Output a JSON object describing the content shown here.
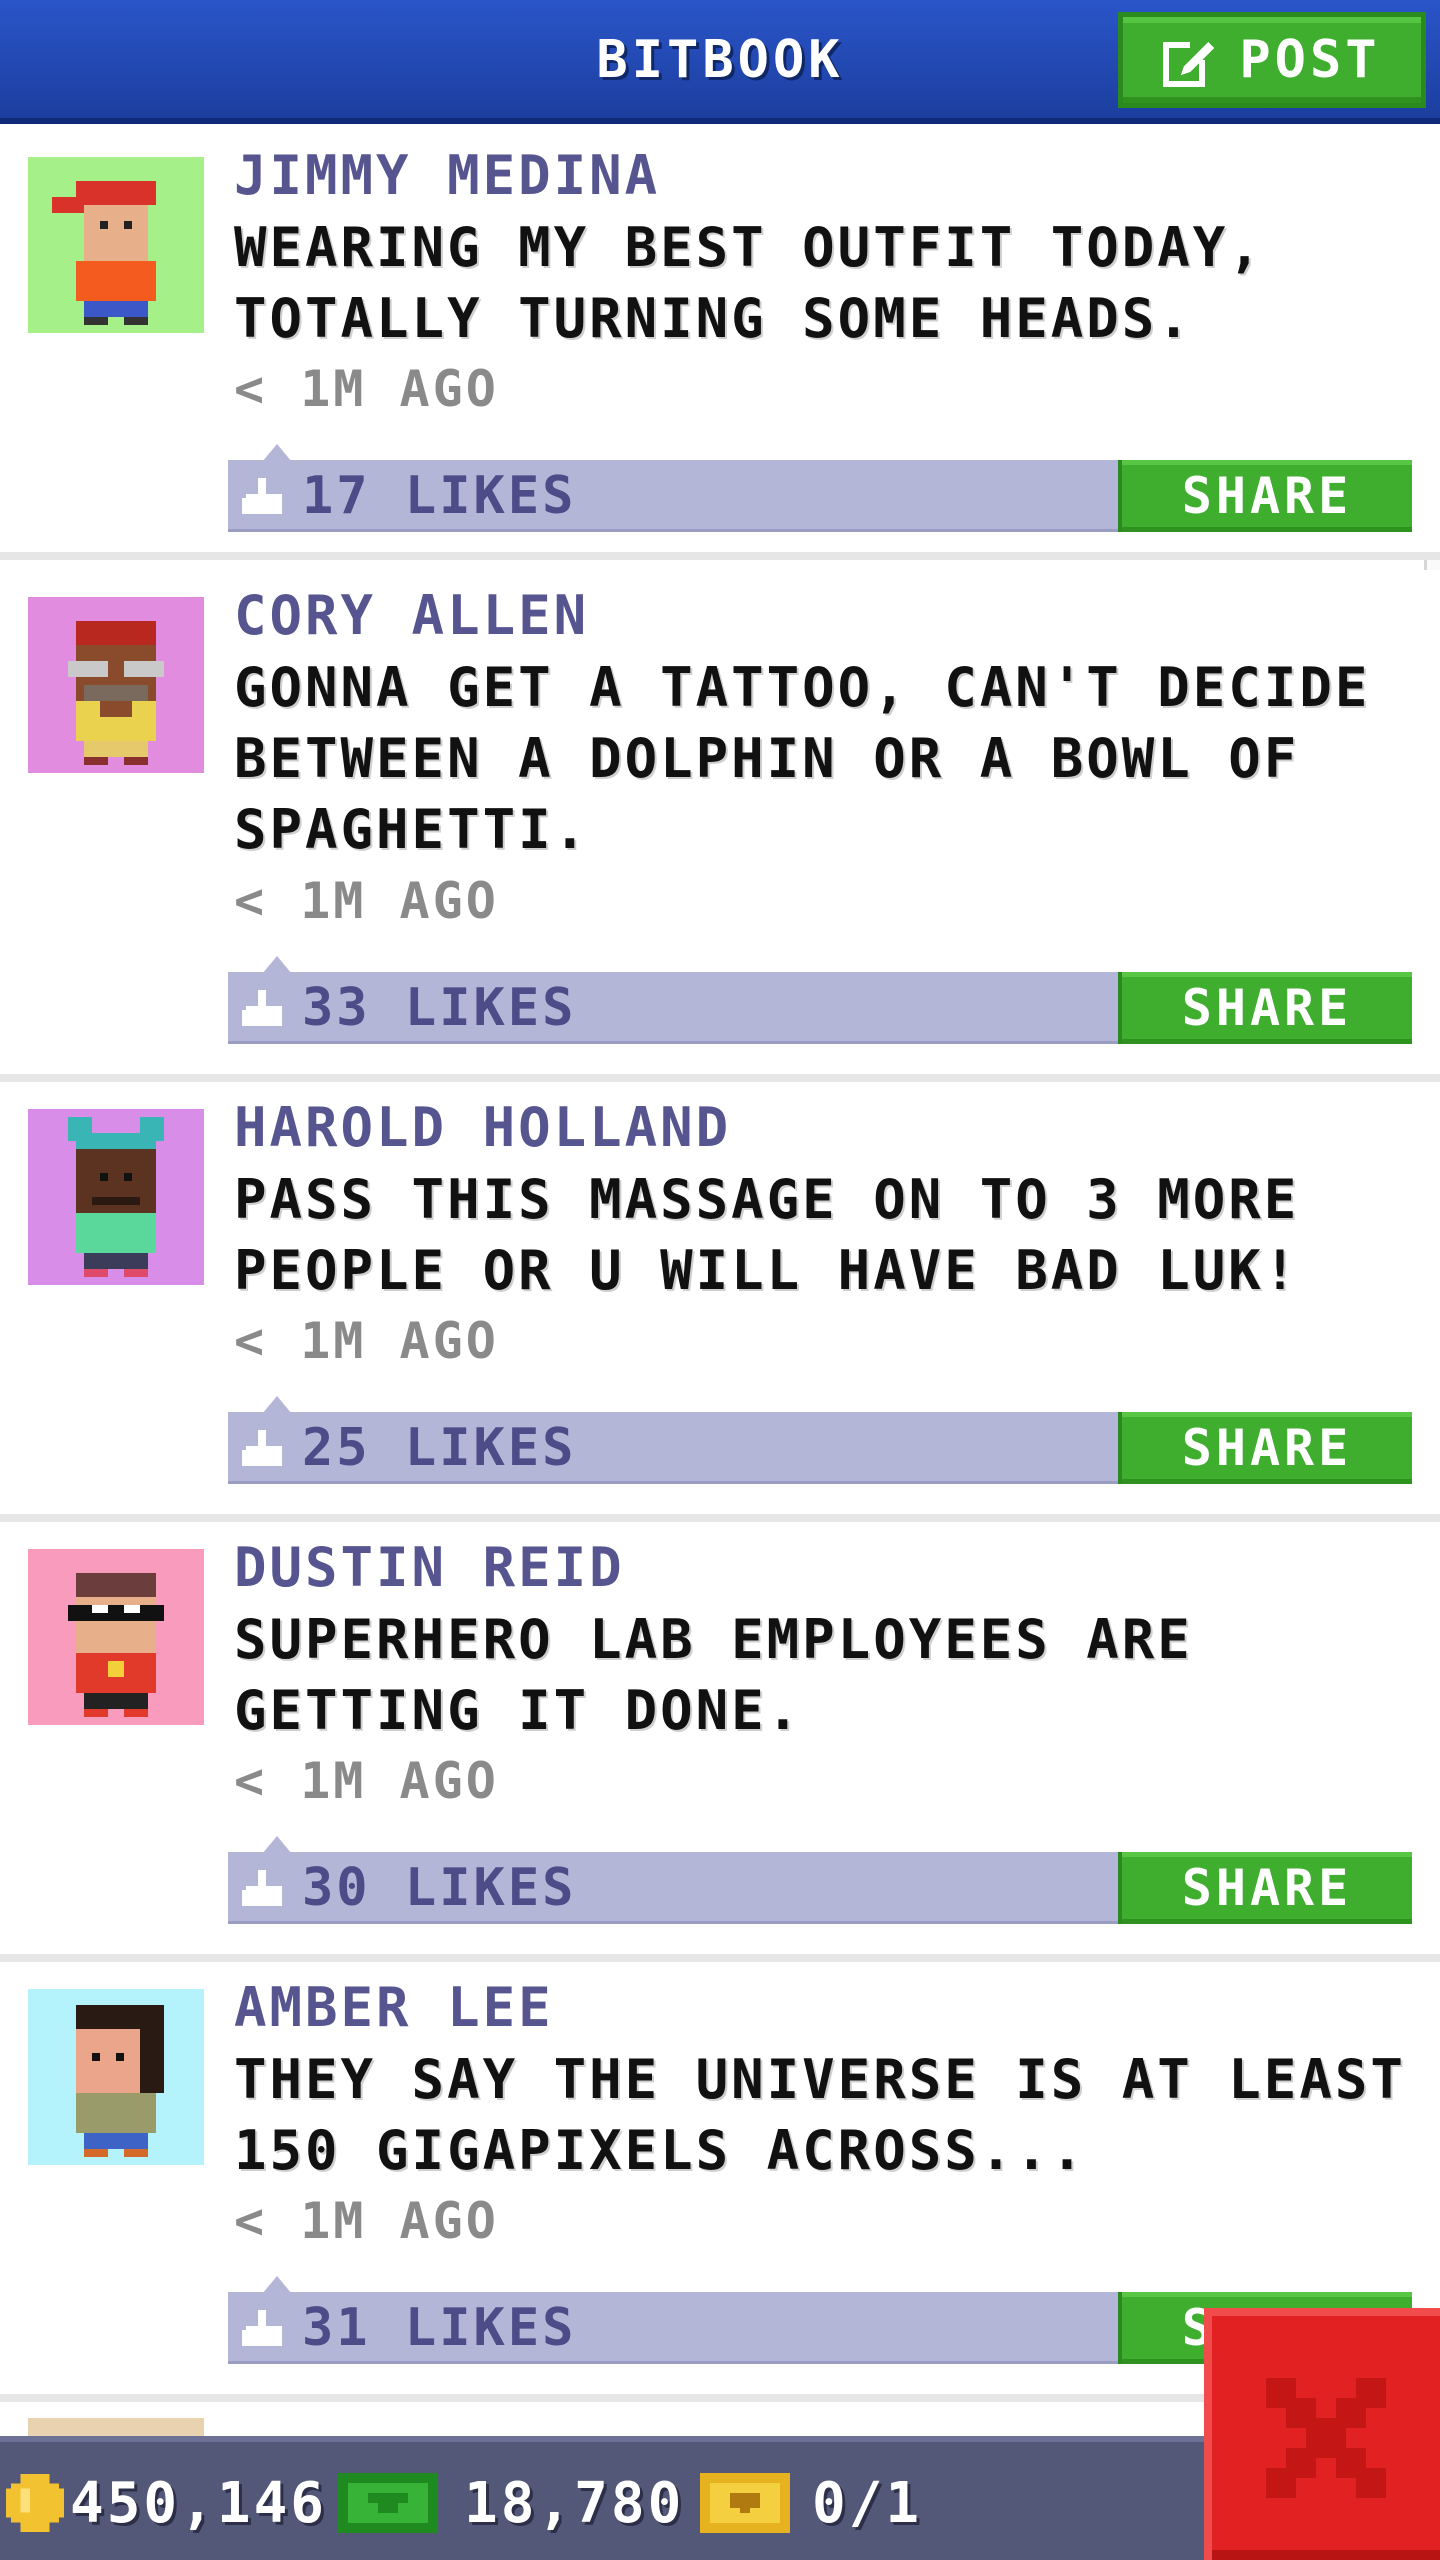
{
  "header": {
    "title": "BITBOOK",
    "post_label": "POST"
  },
  "colors": {
    "header_blue": "#2a55c9",
    "green_button": "#3fae2f",
    "likes_bar": "#b4b6d8",
    "author_text": "#57558f",
    "close_red": "#e22222"
  },
  "posts": [
    {
      "author": "JIMMY MEDINA",
      "text": "WEARING MY BEST OUTFIT TODAY, TOTALLY TURNING SOME HEADS.",
      "time": "< 1M AGO",
      "likes": "17 LIKES",
      "share": "SHARE",
      "avatar_bg": "#a6f08a",
      "avatar_icon": "pixel-person-red-cap-icon"
    },
    {
      "author": "CORY ALLEN",
      "text": "GONNA GET A TATTOO, CAN'T DECIDE BETWEEN A DOLPHIN OR A BOWL OF SPAGHETTI.",
      "time": "< 1M AGO",
      "likes": "33 LIKES",
      "share": "SHARE",
      "avatar_bg": "#e28ce0",
      "avatar_icon": "pixel-person-glasses-icon"
    },
    {
      "author": "HAROLD HOLLAND",
      "text": "PASS THIS MASSAGE ON TO 3 MORE PEOPLE OR U WILL HAVE BAD LUK!",
      "time": "< 1M AGO",
      "likes": "25 LIKES",
      "share": "SHARE",
      "avatar_bg": "#d88ee8",
      "avatar_icon": "pixel-person-teal-ears-icon"
    },
    {
      "author": "DUSTIN REID",
      "text": "SUPERHERO LAB EMPLOYEES ARE GETTING IT DONE.",
      "time": "< 1M AGO",
      "likes": "30 LIKES",
      "share": "SHARE",
      "avatar_bg": "#f89bbd",
      "avatar_icon": "pixel-person-mask-icon"
    },
    {
      "author": "AMBER LEE",
      "text": "THEY SAY THE UNIVERSE IS AT LEAST 150 GIGAPIXELS ACROSS...",
      "time": "< 1M AGO",
      "likes": "31 LIKES",
      "share": "SHARE",
      "avatar_bg": "#b4f3fb",
      "avatar_icon": "pixel-person-dark-hair-icon"
    }
  ],
  "status": {
    "coins": "450,146",
    "bux": "18,780",
    "tickets": "0/1"
  }
}
